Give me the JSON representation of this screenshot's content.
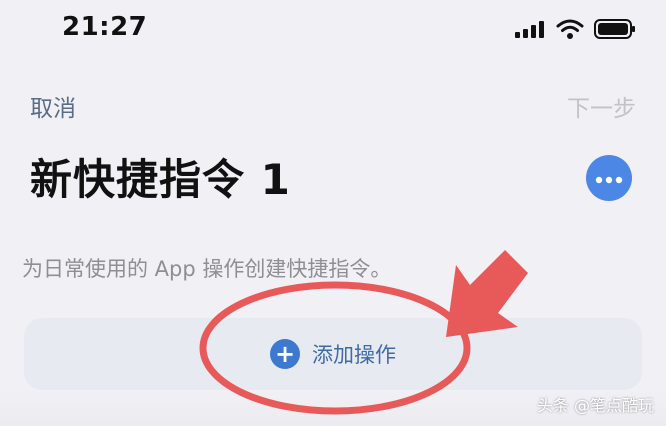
{
  "status_bar": {
    "time": "21:27"
  },
  "nav": {
    "cancel_label": "取消",
    "next_label": "下一步"
  },
  "header": {
    "title": "新快捷指令 1"
  },
  "main": {
    "subtitle": "为日常使用的 App 操作创建快捷指令。",
    "add_action": {
      "label": "添加操作",
      "icon": "plus-circle-icon"
    }
  },
  "overlay": {
    "watermark": "头条 @笔点酷玩"
  },
  "colors": {
    "accent_blue": "#4c87e6",
    "annotation_red": "#e85a5a"
  }
}
